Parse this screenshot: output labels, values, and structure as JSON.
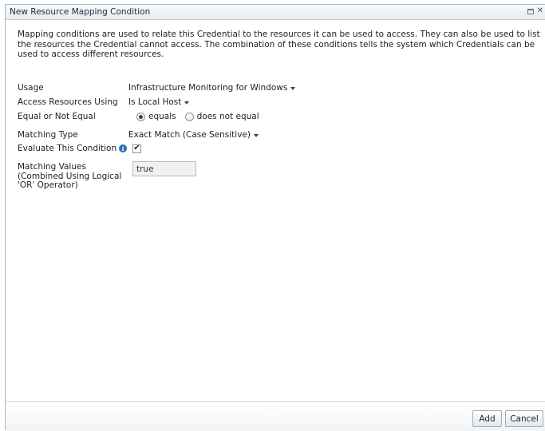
{
  "dialog": {
    "title": "New Resource Mapping Condition",
    "description": "Mapping conditions are used to relate this Credential to the resources it can be used to access. They can also be used to list the resources the Credential cannot access. The combination of these conditions tells the system which Credentials can be used to access different resources."
  },
  "form": {
    "usage": {
      "label": "Usage",
      "value": "Infrastructure Monitoring for Windows"
    },
    "access": {
      "label": "Access Resources Using",
      "value": "Is Local Host"
    },
    "equal": {
      "label": "Equal or Not Equal",
      "option_equals": "equals",
      "option_not_equal": "does not equal",
      "selected": "equals"
    },
    "matching_type": {
      "label": "Matching Type",
      "value": "Exact Match (Case Sensitive)"
    },
    "evaluate": {
      "label": "Evaluate This Condition",
      "checked": true
    },
    "matching_values": {
      "label_line1": "Matching Values",
      "label_line2": "(Combined Using Logical",
      "label_line3": "'OR' Operator)",
      "value": "true"
    }
  },
  "footer": {
    "add_label": "Add",
    "cancel_label": "Cancel"
  }
}
